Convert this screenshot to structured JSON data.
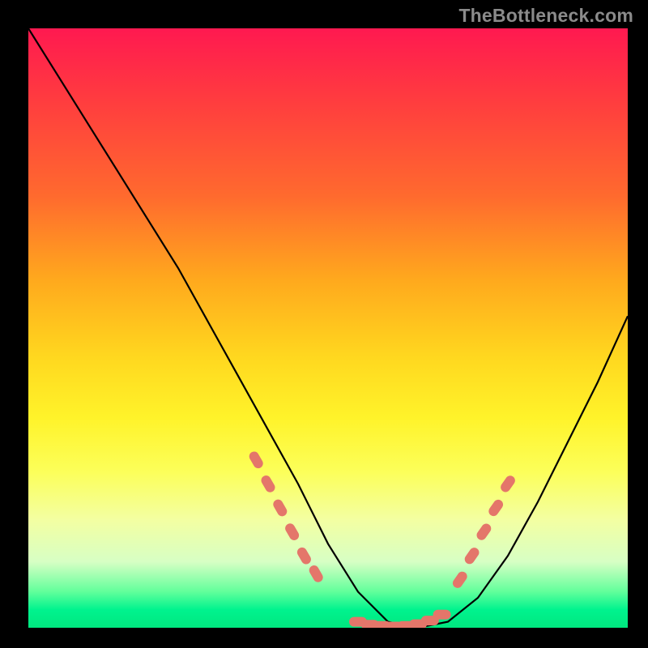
{
  "watermark": "TheBottleneck.com",
  "colors": {
    "background": "#000000",
    "curve": "#000000",
    "marker": "#e4766a",
    "gradient_top": "#ff1950",
    "gradient_bottom": "#00e77f"
  },
  "chart_data": {
    "type": "line",
    "title": "",
    "xlabel": "",
    "ylabel": "",
    "xlim": [
      0,
      100
    ],
    "ylim": [
      0,
      100
    ],
    "series": [
      {
        "name": "curve",
        "x": [
          0,
          5,
          10,
          15,
          20,
          25,
          30,
          35,
          40,
          45,
          50,
          55,
          60,
          65,
          70,
          75,
          80,
          85,
          90,
          95,
          100
        ],
        "y": [
          100,
          92,
          84,
          76,
          68,
          60,
          51,
          42,
          33,
          24,
          14,
          6,
          1,
          0,
          1,
          5,
          12,
          21,
          31,
          41,
          52
        ]
      }
    ],
    "markers_left": [
      {
        "x": 38,
        "y": 28
      },
      {
        "x": 40,
        "y": 24
      },
      {
        "x": 42,
        "y": 20
      },
      {
        "x": 44,
        "y": 16
      },
      {
        "x": 46,
        "y": 12
      },
      {
        "x": 48,
        "y": 9
      }
    ],
    "markers_right": [
      {
        "x": 72,
        "y": 8
      },
      {
        "x": 74,
        "y": 12
      },
      {
        "x": 76,
        "y": 16
      },
      {
        "x": 78,
        "y": 20
      },
      {
        "x": 80,
        "y": 24
      }
    ],
    "markers_bottom": [
      {
        "x": 55,
        "y": 1
      },
      {
        "x": 57,
        "y": 0.5
      },
      {
        "x": 59,
        "y": 0.3
      },
      {
        "x": 61,
        "y": 0.2
      },
      {
        "x": 63,
        "y": 0.3
      },
      {
        "x": 65,
        "y": 0.6
      },
      {
        "x": 67,
        "y": 1.2
      },
      {
        "x": 69,
        "y": 2.2
      }
    ]
  }
}
